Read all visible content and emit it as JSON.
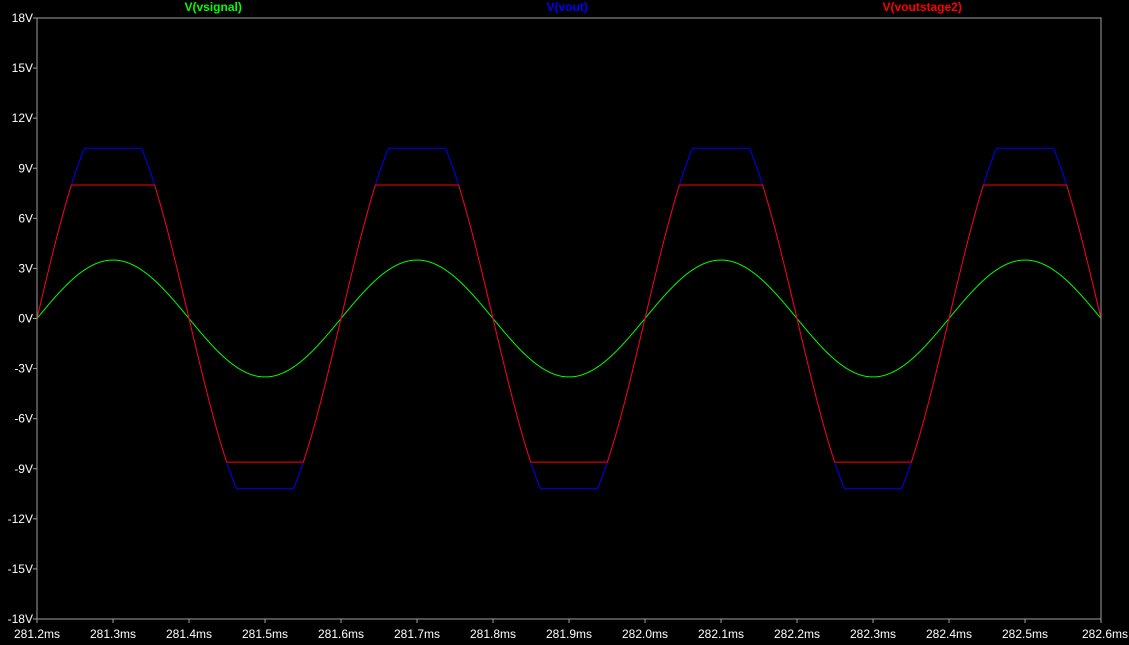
{
  "chart_data": {
    "type": "line",
    "title": "",
    "xlabel": "",
    "ylabel": "",
    "grid": false,
    "legend_placement": "top",
    "background_color": "#000000",
    "axis_color": "#a0a0a0",
    "xlim": [
      281.2,
      282.6
    ],
    "ylim": [
      -18,
      18
    ],
    "x_ticks": [
      "281.2ms",
      "281.3ms",
      "281.4ms",
      "281.5ms",
      "281.6ms",
      "281.7ms",
      "281.8ms",
      "281.9ms",
      "282.0ms",
      "282.1ms",
      "282.2ms",
      "282.3ms",
      "282.4ms",
      "282.5ms",
      "282.6ms"
    ],
    "y_ticks": [
      "18V",
      "15V",
      "12V",
      "9V",
      "6V",
      "3V",
      "0V",
      "-3V",
      "-6V",
      "-9V",
      "-12V",
      "-15V",
      "-18V"
    ],
    "signal_period_ms": 0.4,
    "series": [
      {
        "name": "V(vsignal)",
        "color": "#00ff00",
        "waveform": "sine",
        "amplitude_v": 3.5,
        "zero_crossing_ms": 281.2
      },
      {
        "name": "V(vout)",
        "color": "#0000ff",
        "waveform": "clipped_sine",
        "gain": 3.5,
        "clip_high_v": 10.2,
        "clip_low_v": -10.2
      },
      {
        "name": "V(voutstage2)",
        "color": "#ff0000",
        "waveform": "clipped_sine",
        "gain": 3.5,
        "clip_high_v": 8.0,
        "clip_low_v": -8.6
      }
    ]
  }
}
